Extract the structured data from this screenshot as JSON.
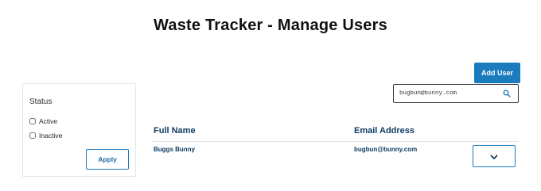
{
  "page": {
    "title": "Waste Tracker - Manage Users"
  },
  "toolbar": {
    "add_user_label": "Add User"
  },
  "search": {
    "value": "bugbun@bunny.com",
    "icon": "search-icon"
  },
  "filters": {
    "title": "Status",
    "options": [
      {
        "label": "Active",
        "checked": false
      },
      {
        "label": "Inactive",
        "checked": false
      }
    ],
    "apply_label": "Apply"
  },
  "table": {
    "columns": [
      "Full Name",
      "Email Address"
    ],
    "rows": [
      {
        "full_name": "Buggs Bunny",
        "email": "bugbun@bunny.com",
        "action_icon": "chevron-down-icon"
      }
    ]
  },
  "colors": {
    "accent": "#1b7bbf",
    "heading": "#0e3c63"
  }
}
